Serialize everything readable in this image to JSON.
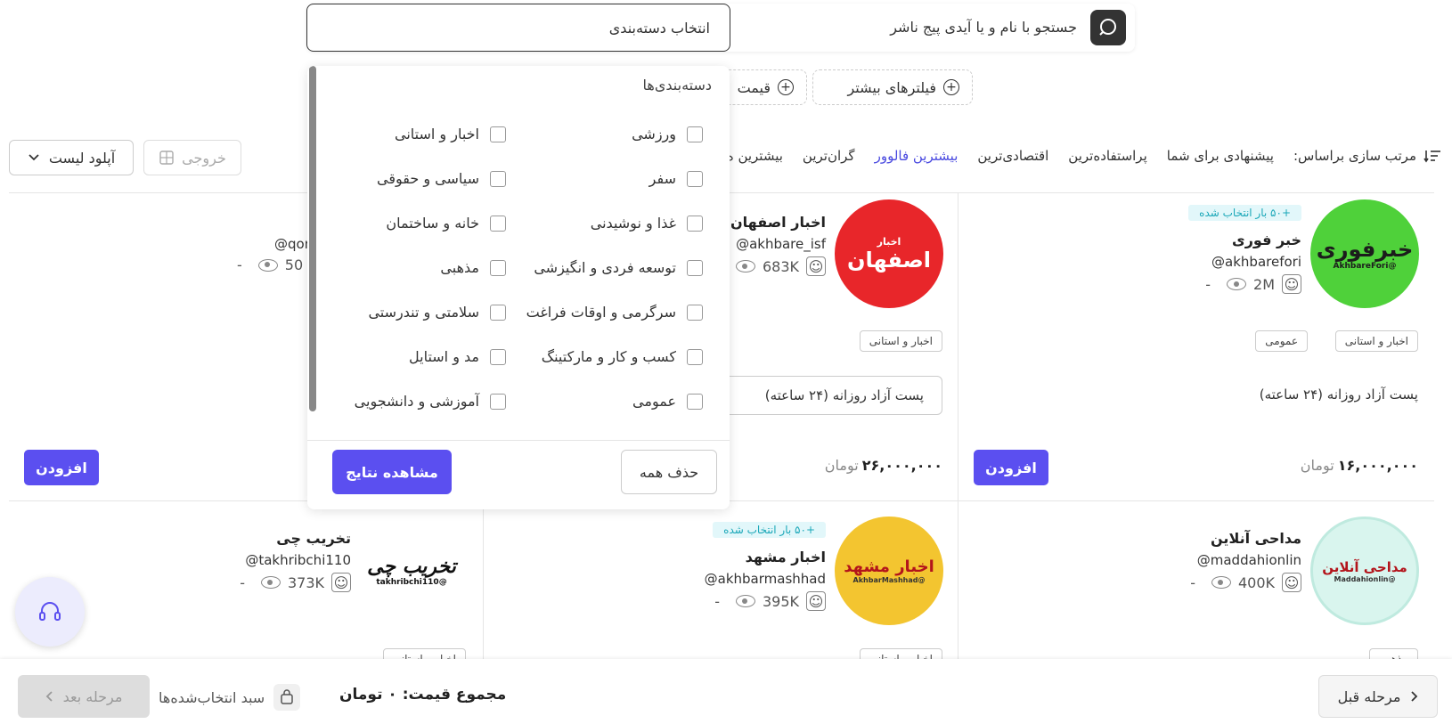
{
  "search": {
    "category_placeholder": "انتخاب دسته‌بندی",
    "text_placeholder": "جستجو با نام و یا آیدی پیج ناشر"
  },
  "filters": {
    "more_filters": "فیلترهای بیشتر",
    "price": "قیمت"
  },
  "sort": {
    "label": "مرتب سازی براساس:",
    "options": [
      "پیشنهادی برای شما",
      "پراستفاده‌ترین",
      "اقتصادی‌ترین",
      "بیشترین فالوور",
      "گران‌ترین",
      "بیشترین ه"
    ],
    "active_index": 3
  },
  "toolbar": {
    "upload": "آپلود لیست",
    "export": "خروجی"
  },
  "dropdown": {
    "title": "دسته‌بندی‌ها",
    "categories_right": [
      "ورزشی",
      "سفر",
      "غذا و نوشیدنی",
      "توسعه فردی و انگیزشی",
      "سرگرمی و اوقات فراغت",
      "کسب و کار و مارکتینگ",
      "عمومی"
    ],
    "categories_left": [
      "اخبار و استانی",
      "سیاسی و حقوقی",
      "خانه و ساختمان",
      "مذهبی",
      "سلامتی و تندرستی",
      "مد و استایل",
      "آموزشی و دانشجویی"
    ],
    "clear_all": "حذف همه",
    "show_results": "مشاهده نتایج"
  },
  "cards": [
    {
      "name": "خبر فوری",
      "handle": "@akhbarefori",
      "followers": "2M",
      "views": "-",
      "badge": "+۵۰ بار انتخاب شده",
      "tags": [
        "اخبار و استانی",
        "عمومی"
      ],
      "post": "پست آزاد روزانه (۲۴ ساعته)",
      "price": "۱۶,۰۰۰,۰۰۰",
      "currency": "تومان",
      "add": "افزودن",
      "avatar_text": "خبرفوری",
      "avatar_sub": "@AkhbareFori"
    },
    {
      "name": "اخبار اصفهان",
      "handle": "@akhbare_isf",
      "followers": "683K",
      "views": "-",
      "tags": [
        "اخبار و استانی"
      ],
      "post": "پست آزاد روزانه (۲۴ ساعته)",
      "price": "۲۶,۰۰۰,۰۰۰",
      "currency": "تومان",
      "avatar_text": "اصفهان",
      "avatar_sub": "اخبار"
    },
    {
      "handle": "@qon",
      "followers": "50",
      "views": "-",
      "add": "افزودن"
    },
    {
      "name": "مداحی آنلاین",
      "handle": "@maddahionlin",
      "followers": "400K",
      "views": "-",
      "tags": [
        "مذهبی"
      ],
      "avatar_text": "مداحی آنلاین",
      "avatar_sub": "@Maddahionlin"
    },
    {
      "name": "اخبار مشهد",
      "handle": "@akhbarmashhad",
      "followers": "395K",
      "views": "-",
      "badge": "+۵۰ بار انتخاب شده",
      "tags": [
        "اخبار و استانی"
      ],
      "avatar_text": "اخبار مشهد",
      "avatar_sub": "@AkhbarMashhad"
    },
    {
      "name": "تخریب چی",
      "handle": "@takhribchi110",
      "followers": "373K",
      "views": "-",
      "tags": [
        "اخبار و استانی"
      ],
      "avatar_text": "تخریب چی",
      "avatar_sub": "@takhribchi110"
    }
  ],
  "bottom": {
    "prev": "مرحله قبل",
    "next": "مرحله بعد",
    "basket": "سبد انتخاب‌شده‌ها",
    "total": "مجموع قیمت: ۰ تومان"
  },
  "colors": {
    "accent": "#5b4ff0",
    "active_sort": "#4a4ae0",
    "badge_bg": "#e2f7fa",
    "badge_text": "#1aa7b8"
  },
  "icons": [
    "search-icon",
    "plus-icon",
    "sort-icon",
    "chevron-down-icon",
    "export-icon",
    "user-icon",
    "eye-icon",
    "basket-icon",
    "chevron-left-icon",
    "chevron-right-icon",
    "headset-icon"
  ]
}
